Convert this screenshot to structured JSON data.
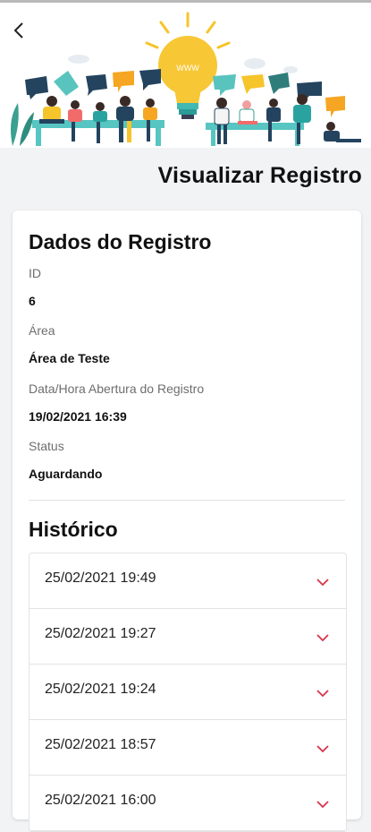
{
  "header": {
    "back_icon": "chevron-left-icon",
    "page_title": "Visualizar Registro",
    "illustration_sign": "WWW"
  },
  "record": {
    "section_title": "Dados do Registro",
    "fields": [
      {
        "label": "ID",
        "value": "6"
      },
      {
        "label": "Área",
        "value": "Área de Teste"
      },
      {
        "label": "Data/Hora Abertura do Registro",
        "value": "19/02/2021 16:39"
      },
      {
        "label": "Status",
        "value": "Aguardando"
      }
    ]
  },
  "history": {
    "section_title": "Histórico",
    "items": [
      {
        "datetime": "25/02/2021 19:49"
      },
      {
        "datetime": "25/02/2021 19:27"
      },
      {
        "datetime": "25/02/2021 19:24"
      },
      {
        "datetime": "25/02/2021 18:57"
      },
      {
        "datetime": "25/02/2021 16:00"
      }
    ],
    "expand_icon": "chevron-down-icon",
    "accent": "#d8344a"
  }
}
